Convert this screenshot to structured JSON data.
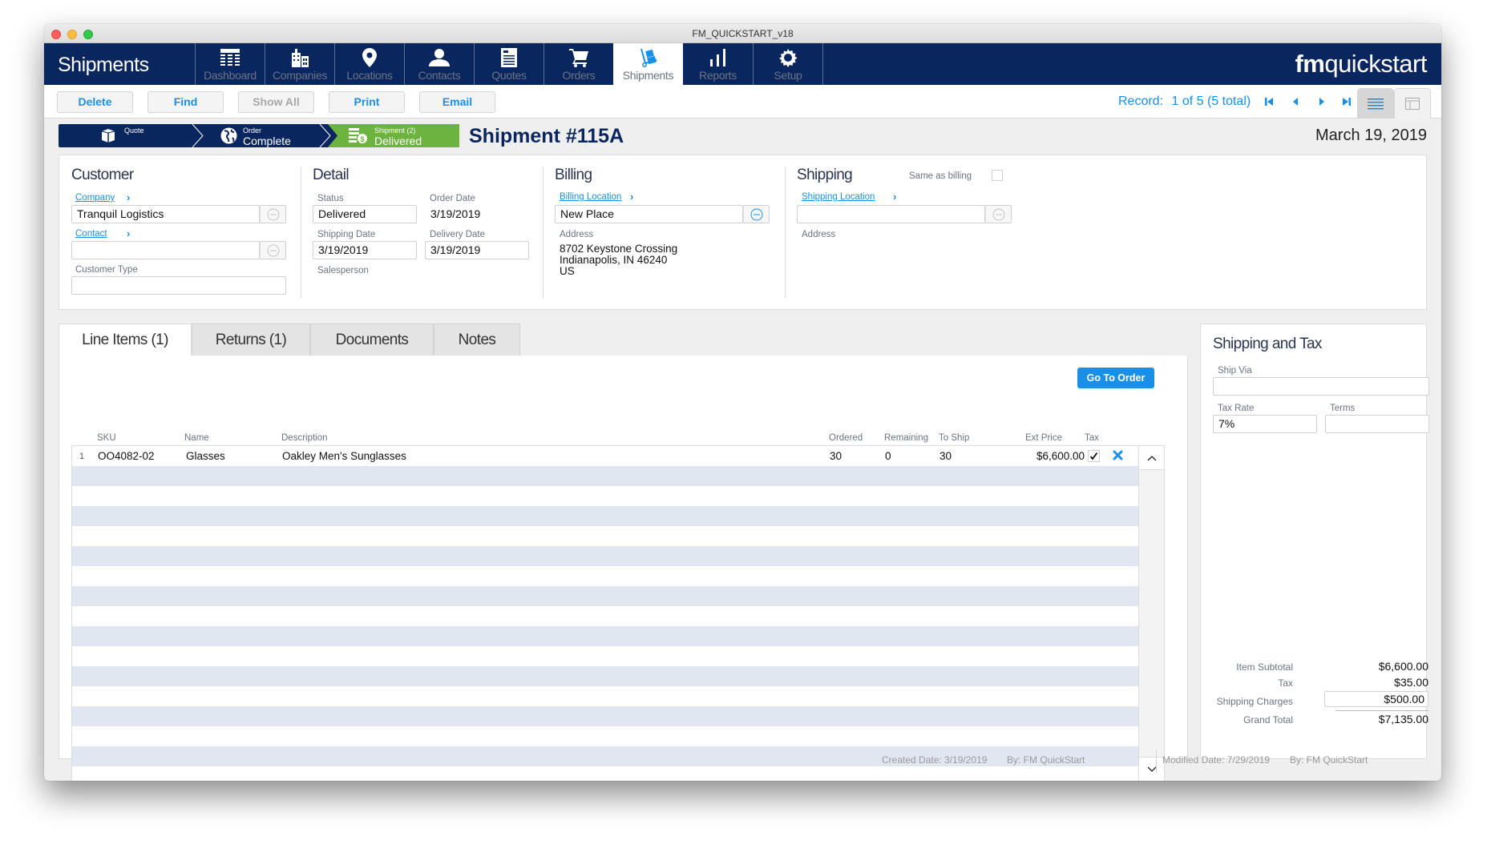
{
  "window": {
    "title": "FM_QUICKSTART_v18"
  },
  "app": {
    "title": "Shipments",
    "brand_bold": "fm",
    "brand_rest": "quickstart"
  },
  "nav": [
    {
      "label": "Dashboard",
      "icon": "dashboard-icon"
    },
    {
      "label": "Companies",
      "icon": "companies-icon"
    },
    {
      "label": "Locations",
      "icon": "location-pin-icon"
    },
    {
      "label": "Contacts",
      "icon": "contact-person-icon"
    },
    {
      "label": "Quotes",
      "icon": "quotes-document-icon"
    },
    {
      "label": "Orders",
      "icon": "cart-icon"
    },
    {
      "label": "Shipments",
      "icon": "hand-truck-icon",
      "active": true
    },
    {
      "label": "Reports",
      "icon": "bar-chart-icon"
    },
    {
      "label": "Setup",
      "icon": "gear-icon"
    }
  ],
  "toolbar": {
    "delete": "Delete",
    "find": "Find",
    "show_all": "Show All",
    "print": "Print",
    "email": "Email",
    "record_label": "Record:",
    "record_value": "1 of 5 (5 total)"
  },
  "progress": {
    "quote": {
      "small": "Quote",
      "big": ""
    },
    "order": {
      "small": "Order",
      "big": "Complete"
    },
    "shipment": {
      "small": "Shipment (2)",
      "big": "Delivered"
    }
  },
  "header": {
    "title": "Shipment #115A",
    "date": "March 19, 2019"
  },
  "customer": {
    "heading": "Customer",
    "company_link": "Company",
    "company_value": "Tranquil Logistics",
    "contact_link": "Contact",
    "contact_value": "",
    "customer_type_label": "Customer Type",
    "customer_type_value": ""
  },
  "detail": {
    "heading": "Detail",
    "status_label": "Status",
    "status_value": "Delivered",
    "order_date_label": "Order Date",
    "order_date_value": "3/19/2019",
    "shipping_date_label": "Shipping Date",
    "shipping_date_value": "3/19/2019",
    "delivery_date_label": "Delivery Date",
    "delivery_date_value": "3/19/2019",
    "salesperson_label": "Salesperson"
  },
  "billing": {
    "heading": "Billing",
    "location_link": "Billing Location",
    "location_value": "New Place",
    "address_label": "Address",
    "address_line1": "8702 Keystone Crossing",
    "address_line2": "Indianapolis, IN 46240",
    "address_line3": "US"
  },
  "shipping": {
    "heading": "Shipping",
    "same_as_billing_label": "Same as billing",
    "same_as_billing_checked": false,
    "location_link": "Shipping Location",
    "location_value": "",
    "address_label": "Address"
  },
  "tabs": [
    {
      "label": "Line Items (1)",
      "active": true
    },
    {
      "label": "Returns (1)"
    },
    {
      "label": "Documents"
    },
    {
      "label": "Notes"
    }
  ],
  "line_items": {
    "go_to_order": "Go To Order",
    "columns": [
      "SKU",
      "Name",
      "Description",
      "Ordered",
      "Remaining",
      "To Ship",
      "Ext Price",
      "Tax"
    ],
    "rows": [
      {
        "num": "1",
        "sku": "OO4082-02",
        "name": "Glasses",
        "description": "Oakley Men's Sunglasses",
        "ordered": "30",
        "remaining": "0",
        "to_ship": "30",
        "ext_price": "$6,600.00",
        "tax": true
      }
    ]
  },
  "shipping_tax": {
    "heading": "Shipping and Tax",
    "ship_via_label": "Ship Via",
    "ship_via_value": "",
    "tax_rate_label": "Tax Rate",
    "tax_rate_value": "7%",
    "terms_label": "Terms",
    "terms_value": "",
    "item_subtotal_label": "Item Subtotal",
    "item_subtotal_value": "$6,600.00",
    "tax_label": "Tax",
    "tax_value": "$35.00",
    "shipping_charges_label": "Shipping Charges",
    "shipping_charges_value": "$500.00",
    "grand_total_label": "Grand Total",
    "grand_total_value": "$7,135.00"
  },
  "footer": {
    "created": "Created Date: 3/19/2019",
    "created_by": "By: FM QuickStart",
    "modified": "Modified Date: 7/29/2019",
    "modified_by": "By: FM QuickStart"
  },
  "colors": {
    "navy": "#0a265e",
    "accent_blue": "#1a8fe8",
    "green": "#6cb33f",
    "stripe": "#e1e7f0"
  }
}
